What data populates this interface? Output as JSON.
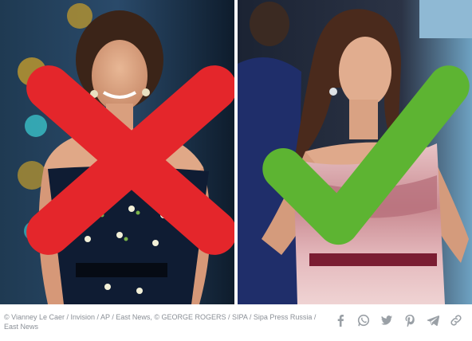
{
  "caption": {
    "credit": "© Vianney Le Caer / Invision / AP / East News, © GEORGE ROGERS / SIPA / Sipa Press Russia / East News"
  },
  "photos": {
    "left": {
      "verdict_icon": "cross-icon",
      "verdict_color": "#e4262b"
    },
    "right": {
      "verdict_icon": "check-icon",
      "verdict_color": "#5db432"
    }
  },
  "share": {
    "icons": [
      "facebook-icon",
      "whatsapp-icon",
      "twitter-icon",
      "pinterest-icon",
      "telegram-icon",
      "copy-link-icon"
    ],
    "icon_color": "#9aa0a6"
  }
}
